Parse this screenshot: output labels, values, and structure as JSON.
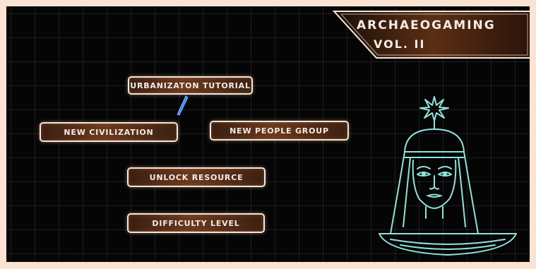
{
  "title": {
    "line1": "ARCHAEOGAMING",
    "line2": "VOL. II"
  },
  "menu": {
    "urbanization_tutorial": "URBANIZATON TUTORIAL",
    "new_civilization": "NEW CIVILIZATION",
    "new_people_group": "NEW PEOPLE GROUP",
    "unlock_resource": "UNLOCK RESOURCE",
    "difficulty_level": "DIFFICULTY LEVEL"
  },
  "colors": {
    "background": "#050505",
    "grid": "#787878",
    "button_fill": "#6a3a1e",
    "button_border": "#f3e6dc",
    "statue_line": "#8fe3dc",
    "cursor": "#3b8dff",
    "outer_border": "#fbe3d3"
  },
  "icons": {
    "cursor": "blue-pointer-cursor",
    "statue": "egyptian-head-statue-icon"
  }
}
